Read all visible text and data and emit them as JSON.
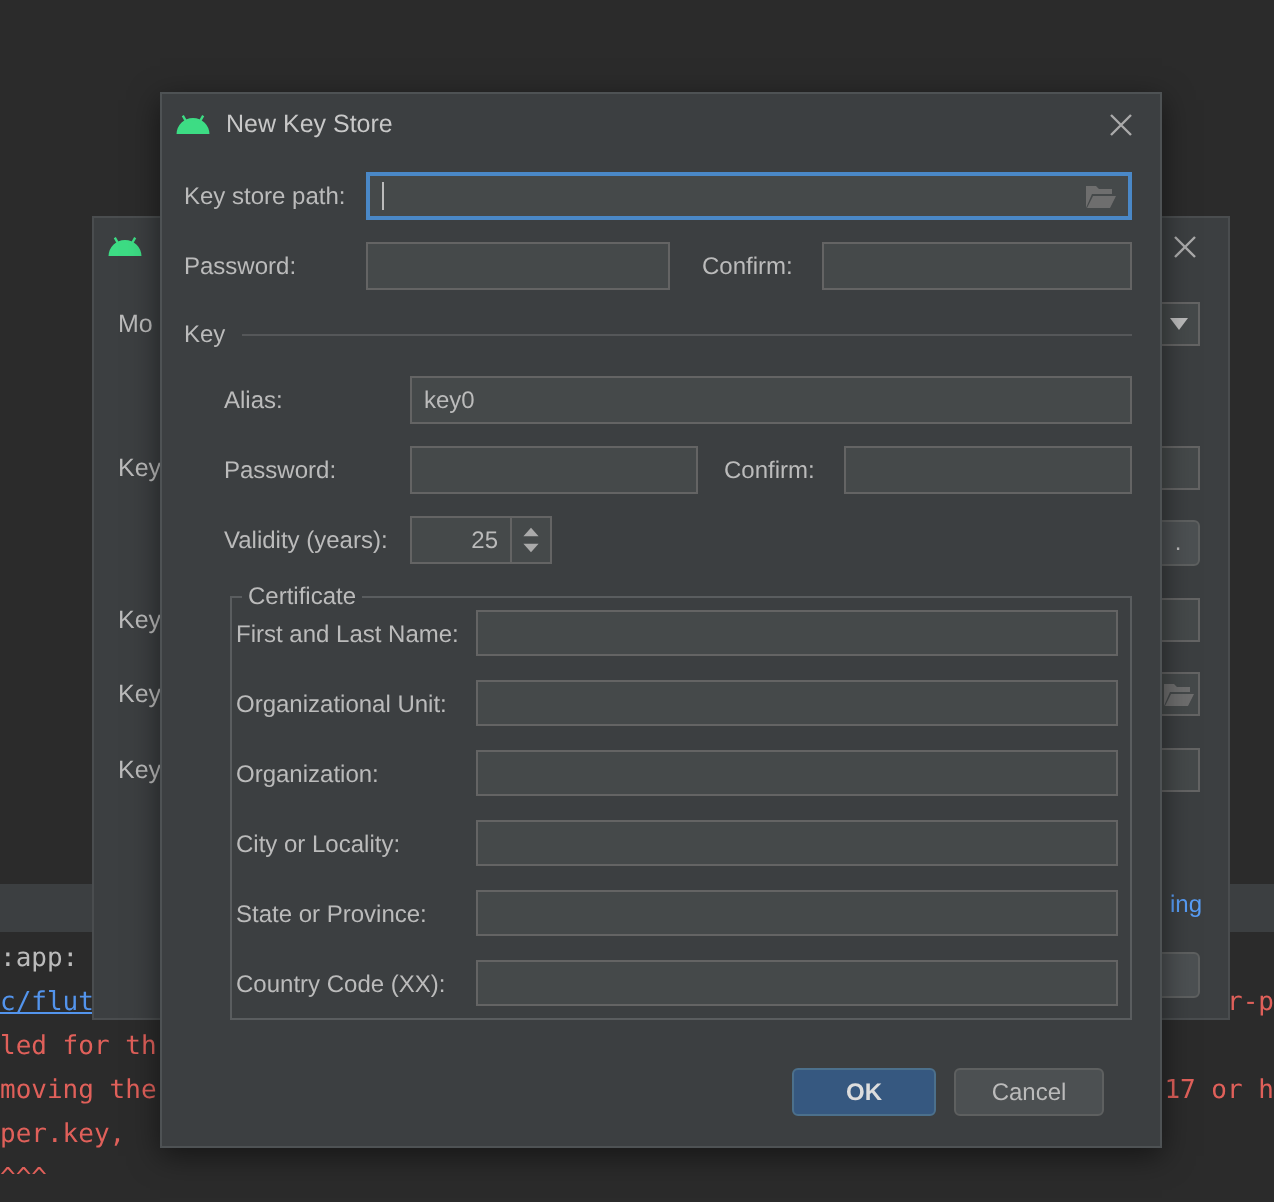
{
  "console": {
    "lines": [
      {
        "left": {
          "text": ":app:",
          "kind": "plain"
        }
      },
      {
        "left": {
          "text": "c/flut",
          "kind": "link"
        },
        "right": {
          "text": "r-p",
          "kind": "error"
        }
      },
      {
        "left": {
          "text": "led for th",
          "kind": "error"
        }
      },
      {
        "left": {
          "text": "moving the",
          "kind": "error"
        },
        "right": {
          "text": "17 or h",
          "kind": "error"
        }
      },
      {
        "left": {
          "text": "per.key,",
          "kind": "error"
        }
      },
      {
        "left": {
          "text": "^^^",
          "kind": "error"
        }
      }
    ]
  },
  "background_dialog": {
    "rows": [
      {
        "label": "Mo",
        "kind": "dropdown"
      },
      {
        "label": "Key",
        "kind": "field"
      },
      {
        "kind": "button",
        "text": "."
      },
      {
        "label": "Key",
        "kind": "field"
      },
      {
        "label": "Key",
        "kind": "folder-field"
      },
      {
        "label": "Key",
        "kind": "field"
      },
      {
        "kind": "link",
        "text": "ing"
      },
      {
        "kind": "button"
      }
    ]
  },
  "dialog": {
    "title": "New Key Store",
    "path": {
      "label": "Key store path:",
      "focused": true
    },
    "password": {
      "label": "Password:",
      "confirm_label": "Confirm:"
    },
    "key": {
      "title": "Key",
      "alias": {
        "label": "Alias:",
        "value": "key0"
      },
      "password": {
        "label": "Password:",
        "confirm_label": "Confirm:"
      },
      "validity": {
        "label": "Validity (years):",
        "value": "25"
      },
      "certificate": {
        "title": "Certificate",
        "fields": [
          {
            "label": "First and Last Name:"
          },
          {
            "label": "Organizational Unit:"
          },
          {
            "label": "Organization:"
          },
          {
            "label": "City or Locality:"
          },
          {
            "label": "State or Province:"
          },
          {
            "label": "Country Code (XX):"
          }
        ]
      }
    },
    "buttons": [
      {
        "label": "OK",
        "default": true
      },
      {
        "label": "Cancel",
        "default": false
      }
    ]
  }
}
